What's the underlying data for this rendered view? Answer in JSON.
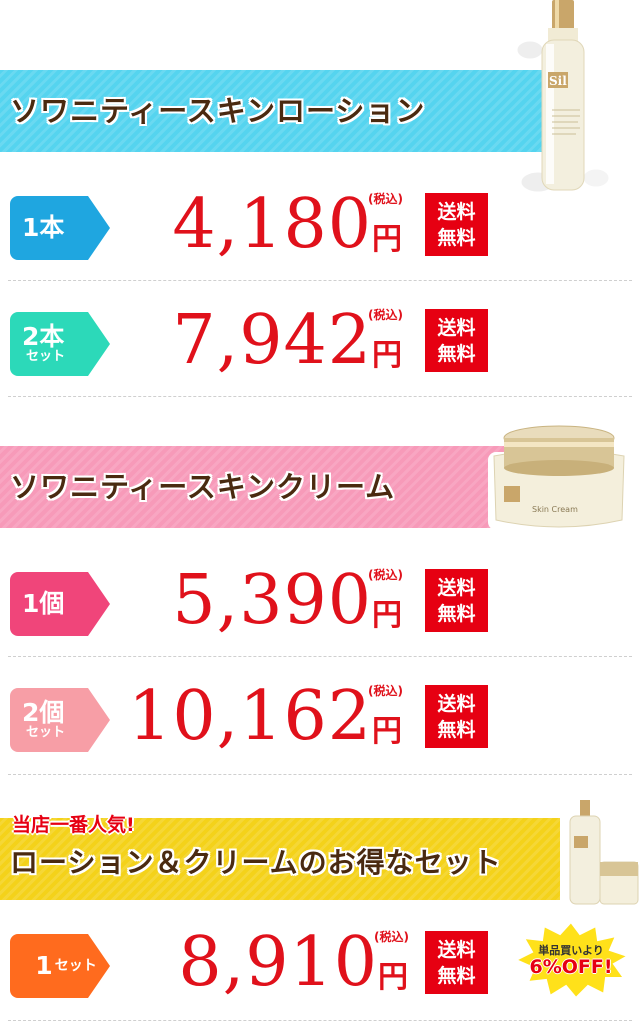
{
  "sections": [
    {
      "title": "ソワニティースキンローション",
      "color": "#55d4ef",
      "rows": [
        {
          "tag_main": "1本",
          "tag_sub": "",
          "tag_color": "#1fa6e0",
          "price": "4,180"
        },
        {
          "tag_main": "2本",
          "tag_sub": "セット",
          "tag_color": "#2cd9b9",
          "price": "7,942"
        }
      ]
    },
    {
      "title": "ソワニティースキンクリーム",
      "color": "#f79ab9",
      "rows": [
        {
          "tag_main": "1個",
          "tag_sub": "",
          "tag_color": "#f0457a",
          "price": "5,390"
        },
        {
          "tag_main": "2個",
          "tag_sub": "セット",
          "tag_color": "#f79ea6",
          "price": "10,162"
        }
      ]
    },
    {
      "badge": "当店一番人気!",
      "title": "ローション＆クリームのお得なセット",
      "color": "#f4d21a",
      "rows": [
        {
          "tag_main": "1",
          "tag_sub": "セット",
          "tag_color": "#ff6b1e",
          "price": "8,910"
        }
      ]
    }
  ],
  "common": {
    "yen": "円",
    "tax": "(税込)",
    "ship_line1": "送料",
    "ship_line2": "無料"
  },
  "discount": {
    "line1": "単品買いより",
    "line2": "6%OFF!"
  },
  "product_labels": {
    "bottle_logo": "Sil",
    "cream_text": "Skin Cream"
  }
}
